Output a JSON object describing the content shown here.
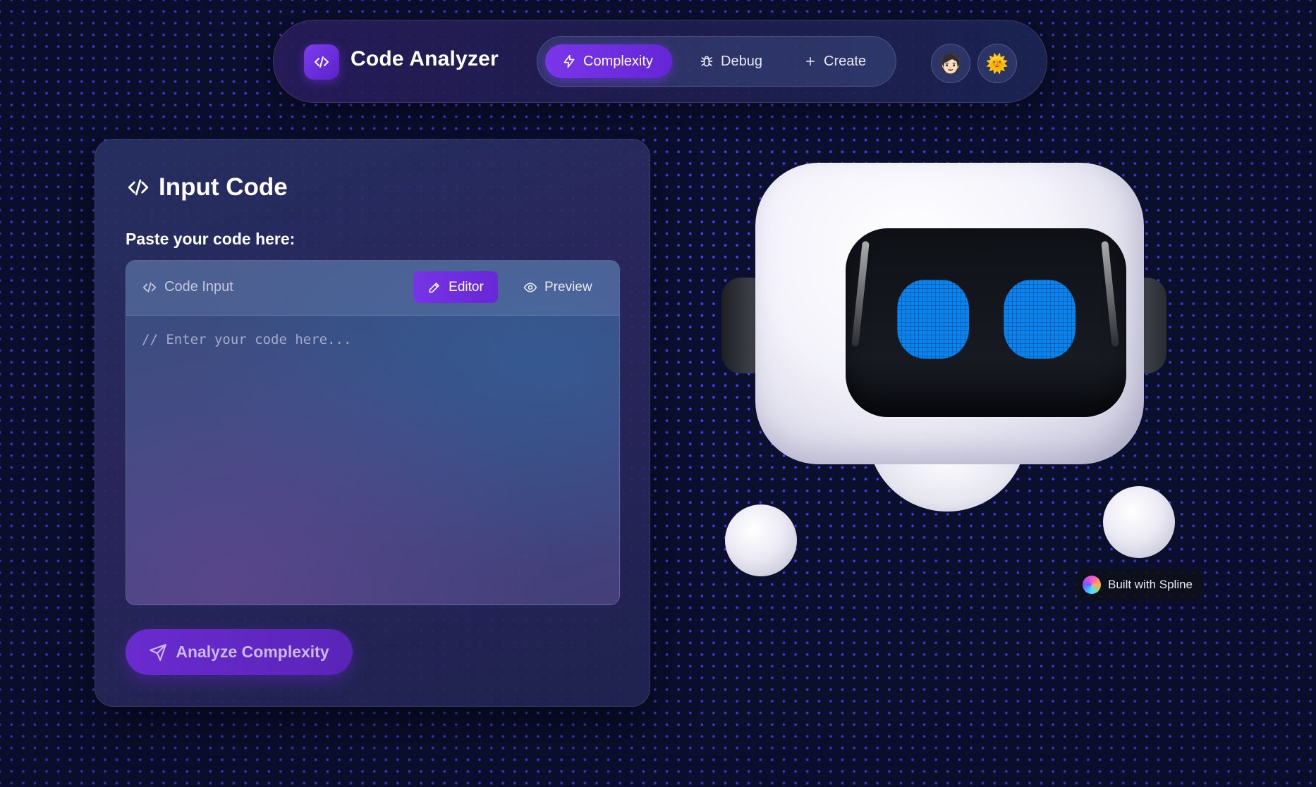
{
  "header": {
    "title": "Code Analyzer",
    "tabs": [
      {
        "label": "Complexity",
        "icon": "lightning-icon",
        "active": true
      },
      {
        "label": "Debug",
        "icon": "bug-icon",
        "active": false
      },
      {
        "label": "Create",
        "icon": "plus-icon",
        "active": false
      }
    ],
    "avatar_emoji": "🧑🏻",
    "theme_emoji": "🌞"
  },
  "card": {
    "title": "Input Code",
    "label": "Paste your code here:",
    "editor": {
      "bar_label": "Code Input",
      "editor_button": "Editor",
      "preview_button": "Preview",
      "placeholder": "// Enter your code here...",
      "value": ""
    },
    "analyze_button": "Analyze Complexity"
  },
  "spline_badge": "Built with Spline",
  "colors": {
    "accent": "#7a36e8",
    "background": "#0b1030",
    "dot": "#5b3cff",
    "eye": "#0a84f0"
  }
}
